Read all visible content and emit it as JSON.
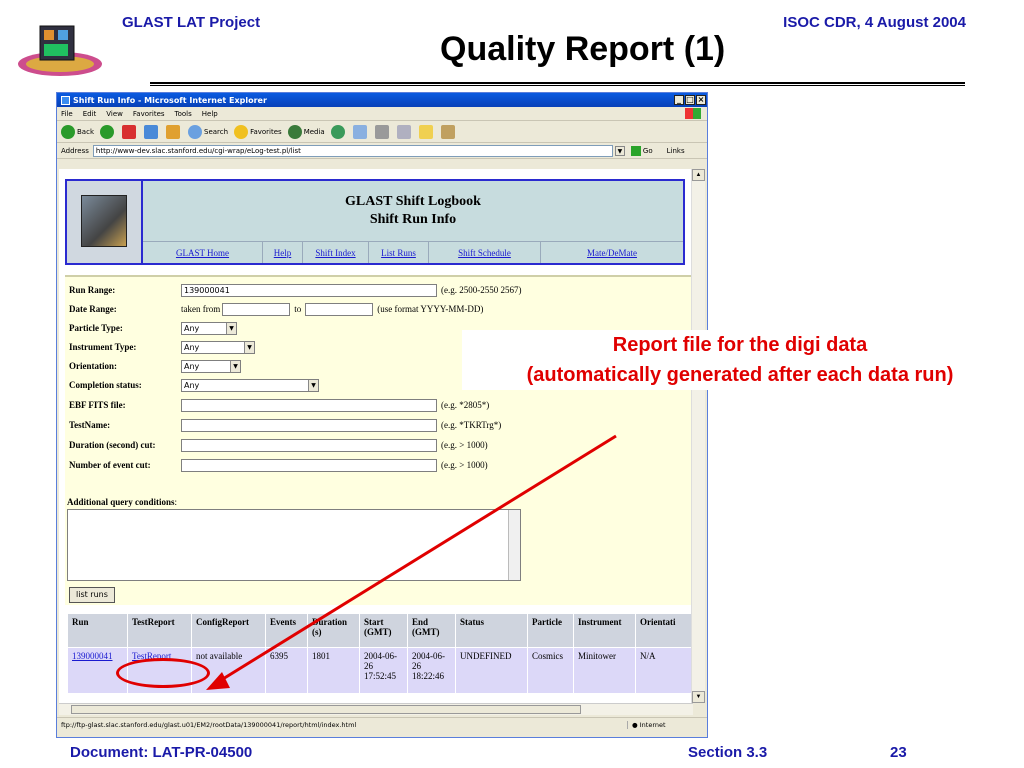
{
  "slide": {
    "header_left": "GLAST LAT Project",
    "header_right": "ISOC CDR, 4 August 2004",
    "title": "Quality Report (1)",
    "footer_doc": "Document:   LAT-PR-04500",
    "footer_section": "Section 3.3",
    "footer_page": "23",
    "callout_line1": "Report file for the digi data",
    "callout_line2": "(automatically generated after each data run)",
    "accent_color": "#e00000"
  },
  "browser": {
    "window_title": "Shift Run Info - Microsoft Internet Explorer",
    "menu": [
      "File",
      "Edit",
      "View",
      "Favorites",
      "Tools",
      "Help"
    ],
    "toolbar": {
      "back": "Back",
      "search": "Search",
      "favorites": "Favorites",
      "media": "Media"
    },
    "address_label": "Address",
    "address_url": "http://www-dev.slac.stanford.edu/cgi-wrap/eLog-test.pl/list",
    "go_label": "Go",
    "links_label": "Links",
    "status_url": "ftp://ftp-glast.slac.stanford.edu/glast.u01/EM2/rootData/139000041/report/html/index.html",
    "status_zone": "Internet"
  },
  "page": {
    "header_title_line1": "GLAST Shift Logbook",
    "header_title_line2": "Shift Run Info",
    "nav": [
      "GLAST Home",
      "Help",
      "Shift Index",
      "List Runs",
      "Shift Schedule",
      "Mate/DeMate"
    ]
  },
  "form": {
    "run_range": {
      "label": "Run Range:",
      "value": "139000041",
      "hint": "(e.g. 2500-2550 2567)"
    },
    "date_range": {
      "label": "Date Range:",
      "taken_from": "taken from",
      "to": "to",
      "hint": "(use format YYYY-MM-DD)"
    },
    "particle_type": {
      "label": "Particle Type:",
      "value": "Any"
    },
    "instrument_type": {
      "label": "Instrument Type:",
      "value": "Any"
    },
    "orientation": {
      "label": "Orientation:",
      "value": "Any"
    },
    "completion_status": {
      "label": "Completion status:",
      "value": "Any"
    },
    "ebf_fits": {
      "label": "EBF FITS file:",
      "hint": "(e.g. *2805*)"
    },
    "test_name": {
      "label": "TestName:",
      "hint": "(e.g. *TKRTrg*)"
    },
    "duration_cut": {
      "label": "Duration (second) cut:",
      "hint": "(e.g. > 1000)"
    },
    "event_cut": {
      "label": "Number of event cut:",
      "hint": "(e.g. > 1000)"
    },
    "additional_label": "Additional query conditions",
    "list_runs_button": "list runs"
  },
  "results": {
    "headers": [
      "Run",
      "TestReport",
      "ConfigReport",
      "Events",
      "Duration (s)",
      "Start (GMT)",
      "End (GMT)",
      "Status",
      "Particle",
      "Instrument",
      "Orientati"
    ],
    "row": {
      "run": "139000041",
      "test_report": "TestReport",
      "config_report": "not available",
      "events": "6395",
      "duration": "1801",
      "start": "2004-06-26 17:52:45",
      "end": "2004-06-26 18:22:46",
      "status": "UNDEFINED",
      "particle": "Cosmics",
      "instrument": "Minitower",
      "orientation": "N/A"
    }
  }
}
